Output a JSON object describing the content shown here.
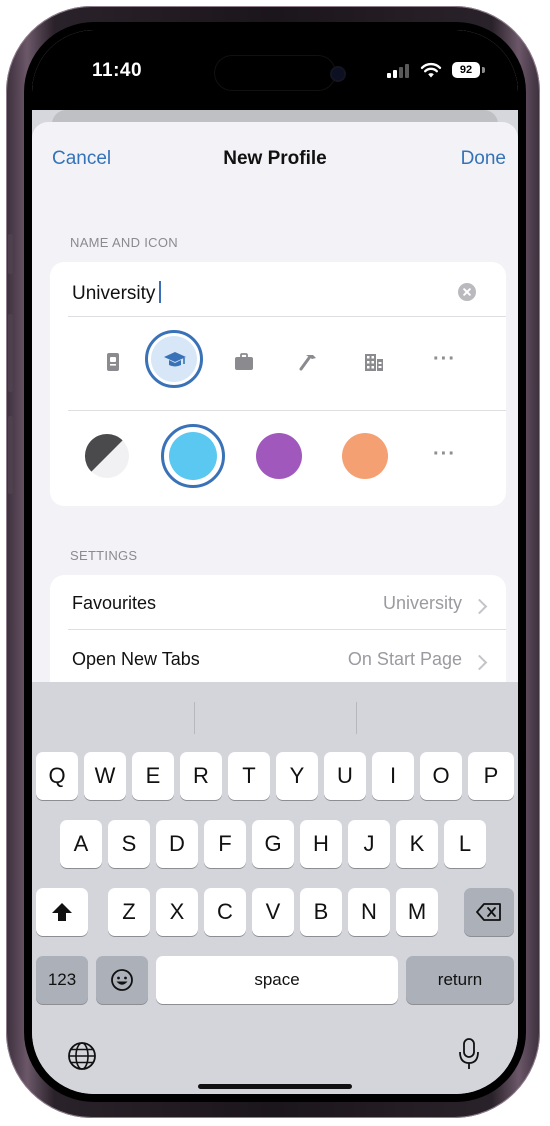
{
  "status_bar": {
    "time": "11:40",
    "battery": "92"
  },
  "nav": {
    "cancel": "Cancel",
    "title": "New Profile",
    "done": "Done"
  },
  "name_section": {
    "header": "NAME AND ICON",
    "name_value": "University",
    "icons": [
      "badge-icon",
      "graduation-cap-icon",
      "briefcase-icon",
      "hammer-icon",
      "building-icon",
      "more-icon"
    ],
    "selected_icon": "graduation-cap-icon",
    "colors": [
      {
        "name": "dark-light",
        "hex": "#4a4a4d"
      },
      {
        "name": "light-blue",
        "hex": "#5ac8f0"
      },
      {
        "name": "purple",
        "hex": "#a158bd"
      },
      {
        "name": "orange",
        "hex": "#f5a073"
      }
    ],
    "selected_color": "light-blue",
    "more": "···"
  },
  "settings_section": {
    "header": "SETTINGS",
    "rows": [
      {
        "label": "Favourites",
        "value": "University"
      },
      {
        "label": "Open New Tabs",
        "value": "On Start Page"
      }
    ]
  },
  "keyboard": {
    "row1": [
      "Q",
      "W",
      "E",
      "R",
      "T",
      "Y",
      "U",
      "I",
      "O",
      "P"
    ],
    "row2": [
      "A",
      "S",
      "D",
      "F",
      "G",
      "H",
      "J",
      "K",
      "L"
    ],
    "row3": [
      "Z",
      "X",
      "C",
      "V",
      "B",
      "N",
      "M"
    ],
    "numbers": "123",
    "space": "space",
    "return": "return"
  },
  "colors": {
    "accent": "#3573b8",
    "sheet_bg": "#f2f2f7",
    "keyboard_bg": "#d3d5db"
  }
}
